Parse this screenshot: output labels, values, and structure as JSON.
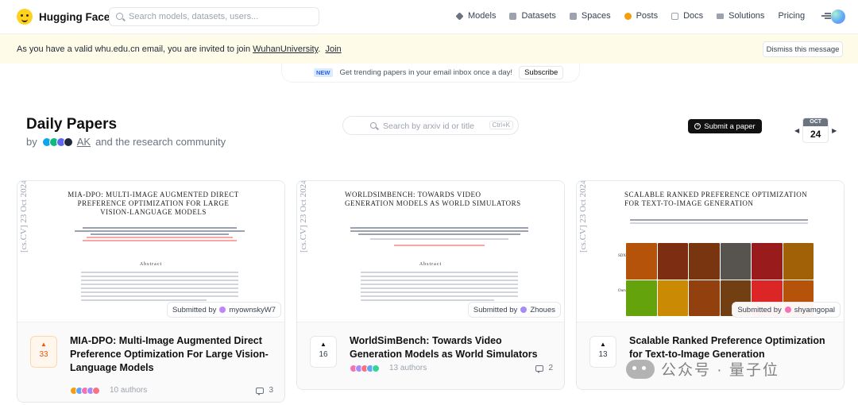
{
  "nav": {
    "brand": "Hugging Face",
    "search_placeholder": "Search models, datasets, users...",
    "items": [
      {
        "label": "Models",
        "icon": "models-icon"
      },
      {
        "label": "Datasets",
        "icon": "datasets-icon"
      },
      {
        "label": "Spaces",
        "icon": "spaces-icon"
      },
      {
        "label": "Posts",
        "icon": "posts-icon"
      },
      {
        "label": "Docs",
        "icon": "docs-icon"
      },
      {
        "label": "Solutions",
        "icon": "solutions-icon"
      }
    ],
    "pricing": "Pricing"
  },
  "banner": {
    "text_before": "As you have a valid whu.edu.cn email, you are invited to join ",
    "org_link": "WuhanUniversity",
    "text_after": ".",
    "join": "Join",
    "dismiss": "Dismiss this message"
  },
  "newsletter": {
    "badge": "NEW",
    "text": "Get trending papers in your email inbox once a day!",
    "subscribe": "Subscribe"
  },
  "header": {
    "title": "Daily Papers",
    "by": "by",
    "ak": "AK",
    "community": "and the research community",
    "search_placeholder": "Search by arxiv id or title",
    "shortcut": "Ctrl+K",
    "submit": "Submit a paper",
    "month": "OCT",
    "day": "24"
  },
  "papers": [
    {
      "thumb_title": "MIA-DPO: Multi-Image Augmented Direct Preference Optimization For Large Vision-Language Models",
      "thumb_side": "[cs.CV] 23 Oct 2024",
      "thumb_abstract": "Abstract",
      "submitted_by": "Submitted by",
      "submitter": "myownskyW7",
      "upvotes": "33",
      "title": "MIA-DPO: Multi-Image Augmented Direct Preference Optimization For Large Vision-Language Models",
      "authors": "10 authors",
      "comments": "3"
    },
    {
      "thumb_title": "WorldSimBench: Towards Video Generation Models as World Simulators",
      "thumb_side": "[cs.CV] 23 Oct 2024",
      "thumb_abstract": "Abstract",
      "submitted_by": "Submitted by",
      "submitter": "Zhoues",
      "upvotes": "16",
      "title": "WorldSimBench: Towards Video Generation Models as World Simulators",
      "authors": "13 authors",
      "comments": "2"
    },
    {
      "thumb_title": "Scalable Ranked Preference Optimization for Text-to-Image Generation",
      "thumb_side": "[cs.CV] 23 Oct 2024",
      "thumb_row1": "SDXL",
      "thumb_row2": "Ours",
      "submitted_by": "Submitted by",
      "submitter": "shyamgopal",
      "upvotes": "13",
      "title": "Scalable Ranked Preference Optimization for Text-to-Image Generation",
      "authors": "",
      "comments": ""
    }
  ],
  "watermark": "公众号 · 量子位",
  "colors": {
    "banner_bg": "#fefce8",
    "hot_upvote": "#ea580c",
    "brand_yellow": "#ffd21e"
  }
}
